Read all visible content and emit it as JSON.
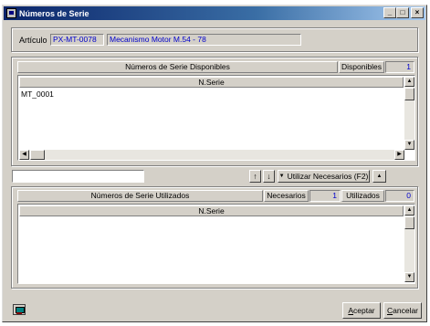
{
  "window": {
    "title": "Números de Serie",
    "minimize": "_",
    "maximize": "□",
    "close": "×"
  },
  "article": {
    "label": "Artículo",
    "code": "PX-MT-0078",
    "description": "Mecanismo Motor M.54 - 78"
  },
  "available": {
    "title": "Números de Serie Disponibles",
    "count_label": "Disponibles",
    "count_value": "1",
    "column_header": "N.Serie",
    "rows": [
      "MT_0001"
    ]
  },
  "controls": {
    "search_value": "",
    "move_up": "↑",
    "move_down": "↓",
    "use_needed_label": "Utilizar Necesarios (F2)",
    "use_needed_arrow": "▼",
    "collapse_arrow": "▲"
  },
  "used": {
    "title": "Números de Serie Utilizados",
    "needed_label": "Necesarios",
    "needed_value": "1",
    "used_label": "Utilizados",
    "used_value": "0",
    "column_header": "N.Serie",
    "rows": []
  },
  "footer": {
    "accept_prefix": "",
    "accept_underlined": "A",
    "accept_rest": "ceptar",
    "cancel_prefix": "",
    "cancel_underlined": "C",
    "cancel_rest": "ancelar"
  },
  "scroll": {
    "up": "▲",
    "down": "▼",
    "left": "◀",
    "right": "▶"
  }
}
